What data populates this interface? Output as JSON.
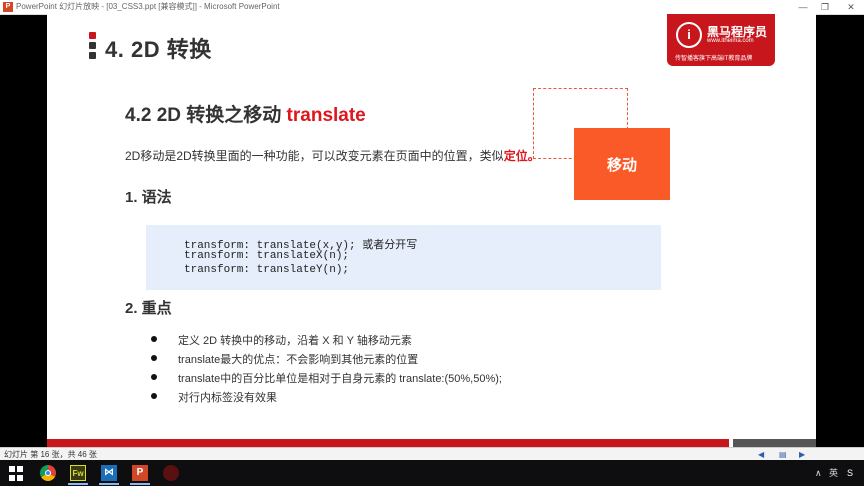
{
  "window": {
    "title": "PowerPoint 幻灯片放映 - [03_CSS3.ppt [兼容模式]] - Microsoft PowerPoint",
    "app_icon": "P",
    "min": "—",
    "max": "❐",
    "close": "✕"
  },
  "slide": {
    "title": "4. 2D 转换",
    "title_bar_colors": [
      "#c8161d",
      "#333333",
      "#333333"
    ],
    "logo": {
      "mark": "i",
      "name": "黑马程序员",
      "url": "www.itheima.com",
      "slogan": "传智播客旗下高端IT教育品牌"
    },
    "subtitle_prefix": "4.2 2D 转换之移动 ",
    "subtitle_highlight": "translate",
    "intro_text": "2D移动是2D转换里面的一种功能，可以改变元素在页面中的位置，类似",
    "intro_highlight": "定位。",
    "demo_box_label": "移动",
    "section1": "1. 语法",
    "code_lines": [
      "transform: translate(x,y); 或者分开写",
      "transform: translateX(n);",
      "transform: translateY(n);"
    ],
    "section2": "2. 重点",
    "bullets": [
      "定义 2D 转换中的移动，沿着 X 和 Y 轴移动元素",
      "translate最大的优点：不会影响到其他元素的位置",
      "translate中的百分比单位是相对于自身元素的 translate:(50%,50%);",
      "对行内标签没有效果"
    ],
    "accent_red": "#c8161d",
    "orange": "#fa5a28"
  },
  "status": {
    "slide_info": "幻灯片 第 16 张，共 46 张",
    "prev": "◀",
    "next": "▶",
    "menu": "▤"
  },
  "taskbar": {
    "fw_label": "Fw",
    "vs_label": "⋈",
    "ppt_label": "P",
    "tray_up": "∧",
    "ime": "英",
    "notify": "S"
  }
}
